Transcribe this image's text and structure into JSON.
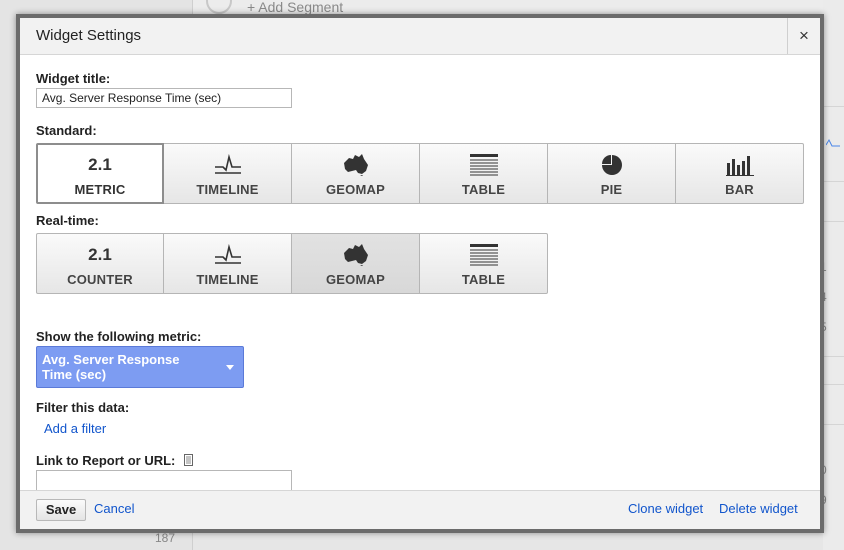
{
  "background": {
    "segment_label": "+ Add Segment",
    "bottom_number": "187",
    "right_numbers": [
      ")",
      "1",
      "4",
      "5",
      ")",
      "0",
      "9"
    ]
  },
  "dialog": {
    "title": "Widget Settings",
    "close_glyph": "×"
  },
  "form": {
    "widget_title_label": "Widget title:",
    "widget_title_value": "Avg. Server Response Time (sec)",
    "standard_label": "Standard:",
    "realtime_label": "Real-time:",
    "metric_label": "Show the following metric:",
    "metric_value": "Avg. Server Response Time (sec)",
    "filter_label": "Filter this data:",
    "add_filter_link": "Add a filter",
    "link_label": "Link to Report or URL:",
    "link_value": ""
  },
  "standard_tiles": [
    {
      "label": "METRIC",
      "icon": "metric-number-icon",
      "icon_text": "2.1",
      "state": "selected"
    },
    {
      "label": "TIMELINE",
      "icon": "timeline-icon",
      "state": "normal"
    },
    {
      "label": "GEOMAP",
      "icon": "geomap-icon",
      "state": "normal"
    },
    {
      "label": "TABLE",
      "icon": "table-icon",
      "state": "normal"
    },
    {
      "label": "PIE",
      "icon": "pie-icon",
      "state": "normal"
    },
    {
      "label": "BAR",
      "icon": "bar-icon",
      "state": "normal"
    }
  ],
  "realtime_tiles": [
    {
      "label": "COUNTER",
      "icon": "counter-number-icon",
      "icon_text": "2.1",
      "state": "normal"
    },
    {
      "label": "TIMELINE",
      "icon": "timeline-icon",
      "state": "normal"
    },
    {
      "label": "GEOMAP",
      "icon": "geomap-icon",
      "state": "pressed"
    },
    {
      "label": "TABLE",
      "icon": "table-icon",
      "state": "normal"
    }
  ],
  "footer": {
    "save_label": "Save",
    "cancel_label": "Cancel",
    "clone_label": "Clone widget",
    "delete_label": "Delete widget"
  },
  "colors": {
    "dropdown_bg": "#7d9cf2",
    "link": "#1155cc",
    "dialog_border": "#6b6b6b"
  }
}
